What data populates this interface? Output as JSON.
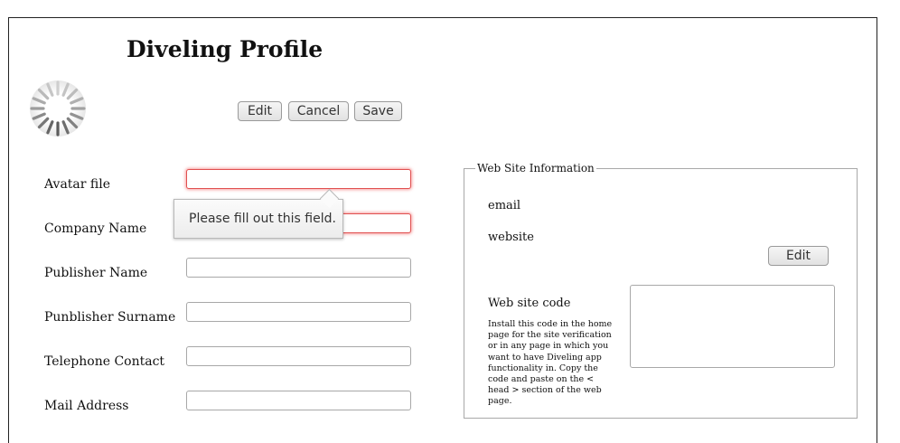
{
  "header": {
    "title": "Diveling Profile"
  },
  "toolbar": {
    "edit_label": "Edit",
    "cancel_label": "Cancel",
    "save_label": "Save"
  },
  "form": {
    "avatar_file": {
      "label": "Avatar file",
      "value": ""
    },
    "company_name": {
      "label": "Company Name",
      "value": ""
    },
    "publisher_name": {
      "label": "Publisher Name",
      "value": ""
    },
    "publisher_surname": {
      "label": "Punblisher Surname",
      "value": ""
    },
    "telephone": {
      "label": "Telephone Contact",
      "value": ""
    },
    "mail_address": {
      "label": "Mail Address",
      "value": ""
    }
  },
  "validation": {
    "tooltip": "Please fill out this field."
  },
  "website_info": {
    "legend": "Web Site Information",
    "email_label": "email",
    "website_label": "website",
    "edit_label": "Edit",
    "code_label": "Web site code",
    "instructions": "Install this code in the home page for the site verification or in any page in which you want to have Diveling app functionality in. Copy the code and paste on the < head > section of the web page.",
    "code_value": ""
  },
  "colors": {
    "invalid_border": "#e05050",
    "tooltip_bg": "#f4f4f4"
  },
  "icons": {
    "avatar": "loading-spinner-icon"
  }
}
